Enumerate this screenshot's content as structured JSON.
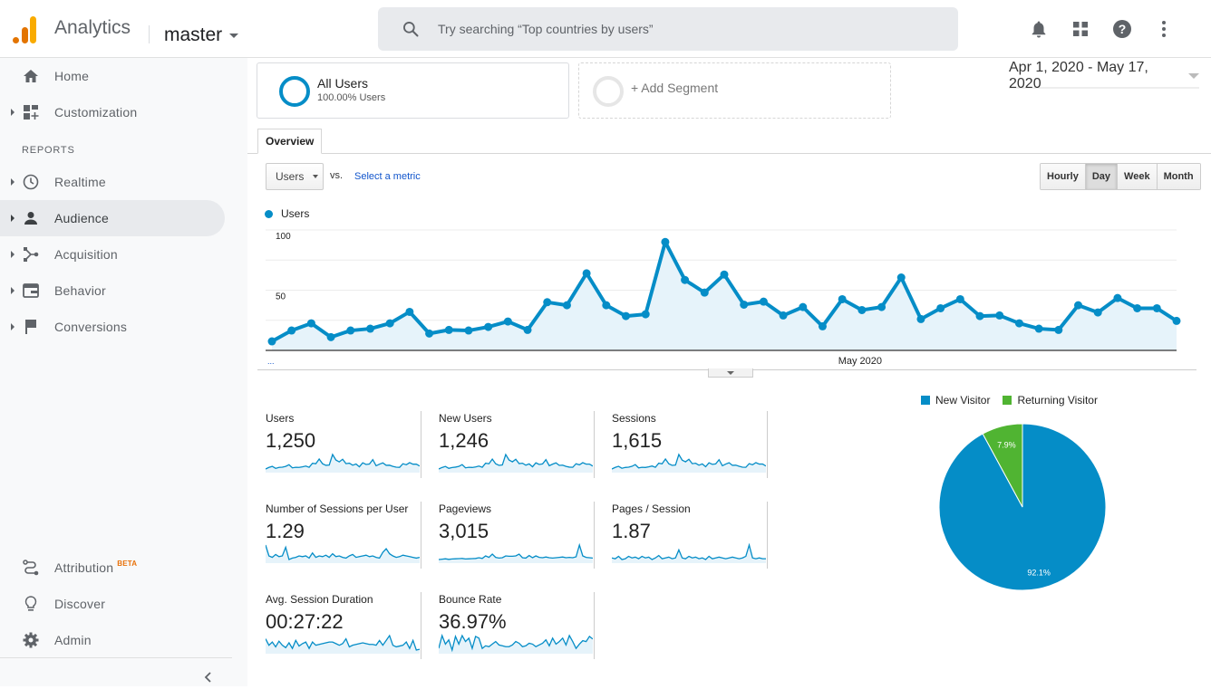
{
  "topbar": {
    "app_title": "Analytics",
    "account": "master",
    "search_placeholder": "Try searching “Top countries by users”",
    "icons": [
      "bell-icon",
      "apps-grid-icon",
      "help-icon",
      "more-vert-icon"
    ]
  },
  "sidebar": {
    "top_items": [
      {
        "label": "Home",
        "icon": "home-icon",
        "expandable": false
      },
      {
        "label": "Customization",
        "icon": "dashboard-add-icon",
        "expandable": true
      }
    ],
    "section_label": "REPORTS",
    "report_items": [
      {
        "label": "Realtime",
        "icon": "clock-icon",
        "expandable": true,
        "active": false
      },
      {
        "label": "Audience",
        "icon": "person-icon",
        "expandable": true,
        "active": true
      },
      {
        "label": "Acquisition",
        "icon": "acquisition-icon",
        "expandable": true,
        "active": false
      },
      {
        "label": "Behavior",
        "icon": "behavior-icon",
        "expandable": true,
        "active": false
      },
      {
        "label": "Conversions",
        "icon": "flag-icon",
        "expandable": true,
        "active": false
      }
    ],
    "bottom_items": [
      {
        "label": "Attribution",
        "badge": "BETA",
        "icon": "attribution-icon"
      },
      {
        "label": "Discover",
        "icon": "lightbulb-icon"
      },
      {
        "label": "Admin",
        "icon": "gear-icon"
      }
    ]
  },
  "segments": {
    "active": {
      "title": "All Users",
      "subtitle": "100.00% Users"
    },
    "add_label": "+ Add Segment"
  },
  "date_range": "Apr 1, 2020 - May 17, 2020",
  "tabs": {
    "overview": "Overview"
  },
  "chart_controls": {
    "metric": "Users",
    "vs": "vs.",
    "select_metric": "Select a metric",
    "granularity": [
      "Hourly",
      "Day",
      "Week",
      "Month"
    ],
    "selected_granularity": "Day"
  },
  "colors": {
    "accent": "#058dc7",
    "fill": "#e6f3fa",
    "returning": "#50b432"
  },
  "chart_data": [
    {
      "type": "area",
      "title": "",
      "legend": [
        "Users"
      ],
      "legend_position": "top-left",
      "x_start": "Apr 1, 2020",
      "x_end": "May 17, 2020",
      "x_tick_labels": [
        "...",
        "May 2020"
      ],
      "ylabel": "",
      "ylim": [
        0,
        100
      ],
      "y_ticks": [
        50,
        100
      ],
      "grid": true,
      "series": [
        {
          "name": "Users",
          "values": [
            7.5,
            16.5,
            22.5,
            11,
            16.5,
            18,
            22.5,
            32,
            14,
            17,
            16.5,
            19.5,
            24,
            17,
            40,
            37.5,
            64,
            37.5,
            28.5,
            30,
            90,
            58.5,
            48,
            63,
            38,
            40.5,
            29,
            36,
            20,
            42.5,
            33.5,
            36,
            60.5,
            26,
            35,
            42.5,
            28.5,
            29,
            22.5,
            18,
            17,
            37.5,
            31.5,
            43.5,
            35,
            35,
            24.5
          ]
        }
      ]
    },
    {
      "type": "pie",
      "title": "",
      "legend": [
        "New Visitor",
        "Returning Visitor"
      ],
      "legend_position": "top",
      "slices": [
        {
          "label": "New Visitor",
          "value": 92.1,
          "display": "92.1%",
          "color": "#058dc7"
        },
        {
          "label": "Returning Visitor",
          "value": 7.9,
          "display": "7.9%",
          "color": "#50b432"
        }
      ]
    }
  ],
  "metrics": [
    {
      "label": "Users",
      "value": "1,250",
      "spark": [
        7.5,
        16.5,
        22.5,
        11,
        16.5,
        18,
        22.5,
        32,
        14,
        17,
        16.5,
        19.5,
        24,
        17,
        40,
        37.5,
        64,
        37.5,
        28.5,
        30,
        90,
        58.5,
        48,
        63,
        38,
        40.5,
        29,
        36,
        20,
        42.5,
        33.5,
        36,
        60.5,
        26,
        35,
        42.5,
        28.5,
        29,
        22.5,
        18,
        17,
        37.5,
        31.5,
        43.5,
        35,
        35,
        24.5
      ]
    },
    {
      "label": "New Users",
      "value": "1,246",
      "spark": [
        7.5,
        16,
        22,
        11,
        16,
        18,
        22,
        32,
        14,
        17,
        16,
        19,
        24,
        17,
        40,
        37,
        63,
        37,
        28,
        30,
        89,
        58,
        48,
        62,
        38,
        40,
        29,
        36,
        20,
        42,
        33,
        36,
        60,
        26,
        35,
        42,
        28,
        29,
        22,
        18,
        17,
        37,
        31,
        43,
        35,
        35,
        24
      ]
    },
    {
      "label": "Sessions",
      "value": "1,615",
      "spark": [
        9,
        20,
        28,
        14,
        20,
        22,
        28,
        40,
        17,
        21,
        20,
        24,
        30,
        21,
        50,
        46,
        80,
        46,
        35,
        37,
        112,
        72,
        60,
        78,
        47,
        50,
        36,
        45,
        25,
        53,
        42,
        45,
        75,
        32,
        44,
        53,
        35,
        36,
        28,
        22,
        21,
        47,
        39,
        54,
        44,
        44,
        30
      ]
    },
    {
      "label": "Number of Sessions per User",
      "value": "1.29",
      "spark": [
        1.45,
        1.3,
        1.28,
        1.32,
        1.29,
        1.3,
        1.42,
        1.25,
        1.27,
        1.28,
        1.3,
        1.29,
        1.3,
        1.27,
        1.34,
        1.28,
        1.3,
        1.29,
        1.31,
        1.28,
        1.33,
        1.29,
        1.3,
        1.28,
        1.27,
        1.3,
        1.32,
        1.28,
        1.29,
        1.3,
        1.31,
        1.29,
        1.3,
        1.28,
        1.27,
        1.35,
        1.4,
        1.33,
        1.3,
        1.28,
        1.29,
        1.31,
        1.3,
        1.29,
        1.28,
        1.27,
        1.28
      ]
    },
    {
      "label": "Pageviews",
      "value": "3,015",
      "spark": [
        10,
        12,
        14,
        11,
        13,
        14,
        15,
        16,
        13,
        14,
        15,
        16,
        20,
        16,
        30,
        22,
        40,
        22,
        18,
        20,
        30,
        28,
        28,
        30,
        40,
        20,
        18,
        32,
        20,
        30,
        22,
        20,
        24,
        20,
        18,
        20,
        22,
        24,
        20,
        22,
        20,
        25,
        90,
        30,
        22,
        20,
        18
      ]
    },
    {
      "label": "Pages / Session",
      "value": "1.87",
      "spark": [
        1.8,
        1.75,
        1.9,
        1.7,
        1.75,
        1.9,
        1.8,
        1.85,
        1.75,
        1.9,
        1.8,
        1.85,
        1.7,
        1.8,
        1.95,
        1.75,
        1.8,
        1.85,
        1.75,
        1.8,
        2.3,
        1.8,
        1.75,
        1.9,
        1.8,
        1.85,
        1.75,
        1.8,
        1.7,
        1.9,
        1.75,
        1.8,
        1.85,
        1.8,
        1.75,
        1.8,
        1.85,
        1.8,
        1.75,
        1.8,
        1.9,
        2.6,
        1.8,
        1.75,
        1.8,
        1.75,
        1.75
      ]
    },
    {
      "label": "Avg. Session Duration",
      "value": "00:27:22",
      "spark": [
        30,
        22,
        26,
        20,
        27,
        22,
        19,
        25,
        18,
        28,
        21,
        24,
        26,
        18,
        26,
        22,
        23,
        24,
        25,
        26,
        26,
        24,
        22,
        24,
        30,
        20,
        22,
        23,
        24,
        25,
        24,
        23,
        23,
        22,
        28,
        22,
        28,
        34,
        22,
        20,
        21,
        22,
        26,
        18,
        28,
        16,
        17
      ]
    },
    {
      "label": "Bounce Rate",
      "value": "36.97%",
      "spark": [
        30,
        45,
        35,
        40,
        28,
        44,
        35,
        45,
        38,
        42,
        30,
        44,
        42,
        30,
        33,
        32,
        35,
        38,
        34,
        33,
        32,
        32,
        34,
        38,
        36,
        32,
        33,
        36,
        35,
        32,
        34,
        36,
        40,
        33,
        42,
        35,
        38,
        42,
        34,
        45,
        38,
        30,
        35,
        39,
        38,
        44,
        41
      ]
    }
  ]
}
